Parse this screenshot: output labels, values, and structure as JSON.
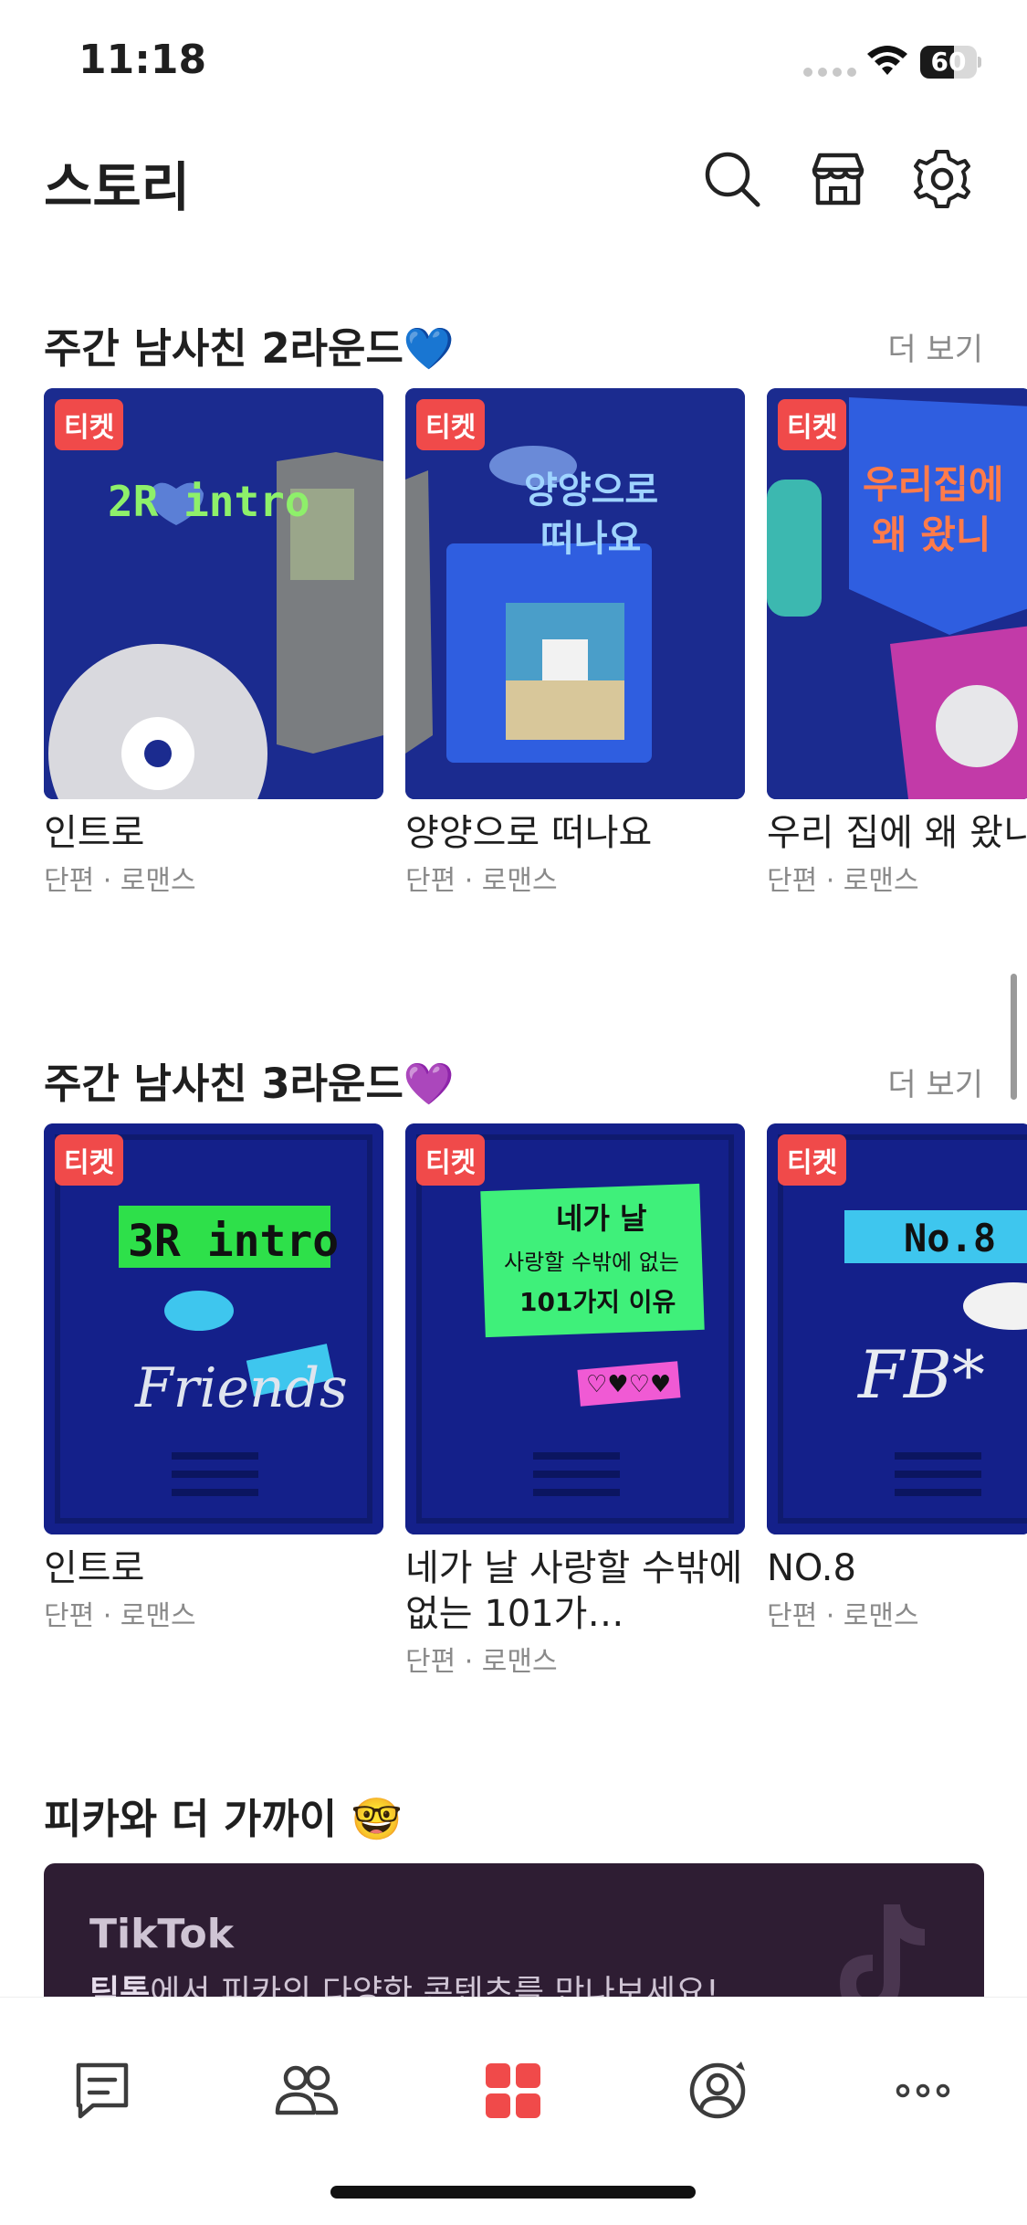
{
  "status_bar": {
    "time": "11:18",
    "battery": "60",
    "battery_level": 0.6
  },
  "header": {
    "title": "스토리",
    "icons": [
      "search-icon",
      "store-icon",
      "gear-icon"
    ]
  },
  "sections": [
    {
      "title": "주간 남사친 2라운드💙",
      "more_label": "더 보기",
      "cards": [
        {
          "badge": "티켓",
          "title": "인트로",
          "meta": "단편 · 로맨스",
          "thumb_text": "2R intro"
        },
        {
          "badge": "티켓",
          "title": "양양으로 떠나요",
          "meta": "단편 · 로맨스",
          "thumb_text": "양양으로 떠나요"
        },
        {
          "badge": "티켓",
          "title": "우리 집에 왜 왔니",
          "meta": "단편 · 로맨스",
          "thumb_text": "우리집에 왜 왔니"
        }
      ]
    },
    {
      "title": "주간 남사친 3라운드💜",
      "more_label": "더 보기",
      "cards": [
        {
          "badge": "티켓",
          "title": "인트로",
          "meta": "단편 · 로맨스",
          "thumb_text": "3R intro"
        },
        {
          "badge": "티켓",
          "title": "네가 날 사랑할 수밖에 없는 101가…",
          "meta": "단편 · 로맨스",
          "thumb_text": "네가 날 사랑할 수밖에 없는 101가지 이유"
        },
        {
          "badge": "티켓",
          "title": "NO.8",
          "meta": "단편 · 로맨스",
          "thumb_text": "No.8"
        }
      ]
    }
  ],
  "promo": {
    "title": "피카와 더 가까이 🤓",
    "banner_title": "TikTok",
    "banner_highlight": "틱톡",
    "banner_text": "에서 피카의 다양한 콘텐츠를 만나보세요!"
  },
  "bottom_nav": {
    "items": [
      "chat-icon",
      "friends-icon",
      "story-icon",
      "profile-icon",
      "more-icon"
    ],
    "active": "story-icon",
    "active_color": "#f04a4a"
  },
  "colors": {
    "ticket": "#f04a4a",
    "card_bg": "#1c2a8c",
    "banner_bg": "#2e1d33"
  }
}
